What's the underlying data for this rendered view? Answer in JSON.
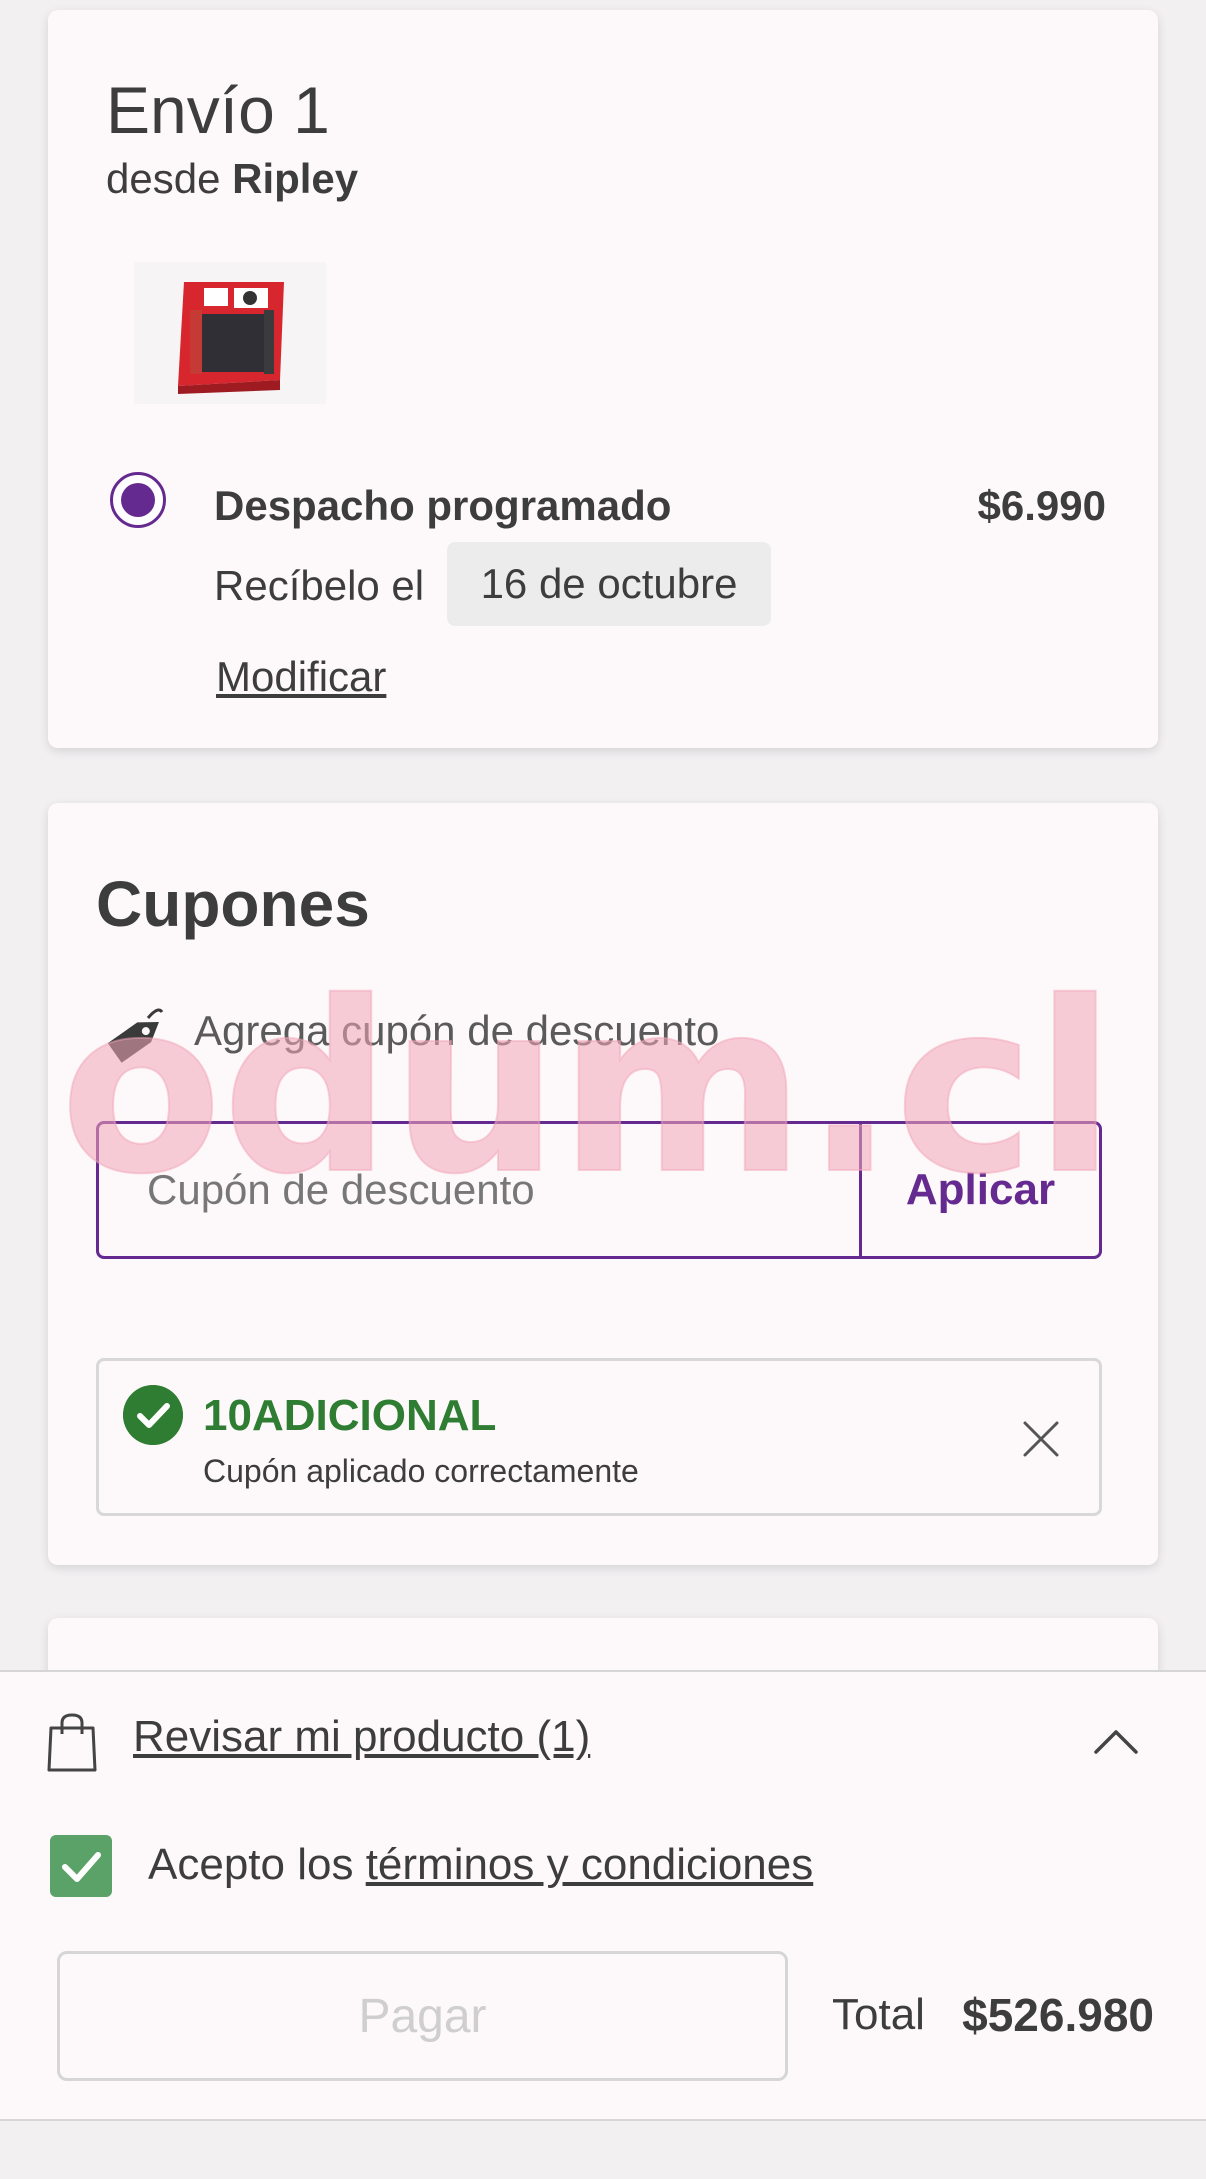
{
  "shipment": {
    "title": "Envío 1",
    "from_prefix": "desde",
    "from_store": "Ripley",
    "product_image_alt": "Nintendo Switch box",
    "option_title": "Despacho programado",
    "option_price": "$6.990",
    "receive_label": "Recíbelo el",
    "receive_date": "16 de octubre",
    "modify_label": "Modificar"
  },
  "coupons": {
    "title": "Cupones",
    "subtitle": "Agrega cupón de descuento",
    "input_placeholder": "Cupón de descuento",
    "apply_label": "Aplicar",
    "applied_code": "10ADICIONAL",
    "applied_message": "Cupón aplicado correctamente"
  },
  "watermark": {
    "text": "odum.cl",
    "color": "#f2a6b8"
  },
  "bottom_sheet": {
    "review_label": "Revisar mi producto (1)",
    "terms_prefix": "Acepto los ",
    "terms_link": "términos y condiciones",
    "terms_checked": true,
    "pay_label": "Pagar",
    "total_label": "Total",
    "total_value": "$526.980"
  },
  "colors": {
    "accent": "#652a8f",
    "success": "#2e7d32",
    "checkbox": "#5aa267"
  },
  "icons": [
    "tag-icon",
    "check-circle-icon",
    "close-icon",
    "shopping-bag-icon",
    "chevron-up-icon",
    "checkmark-icon"
  ]
}
